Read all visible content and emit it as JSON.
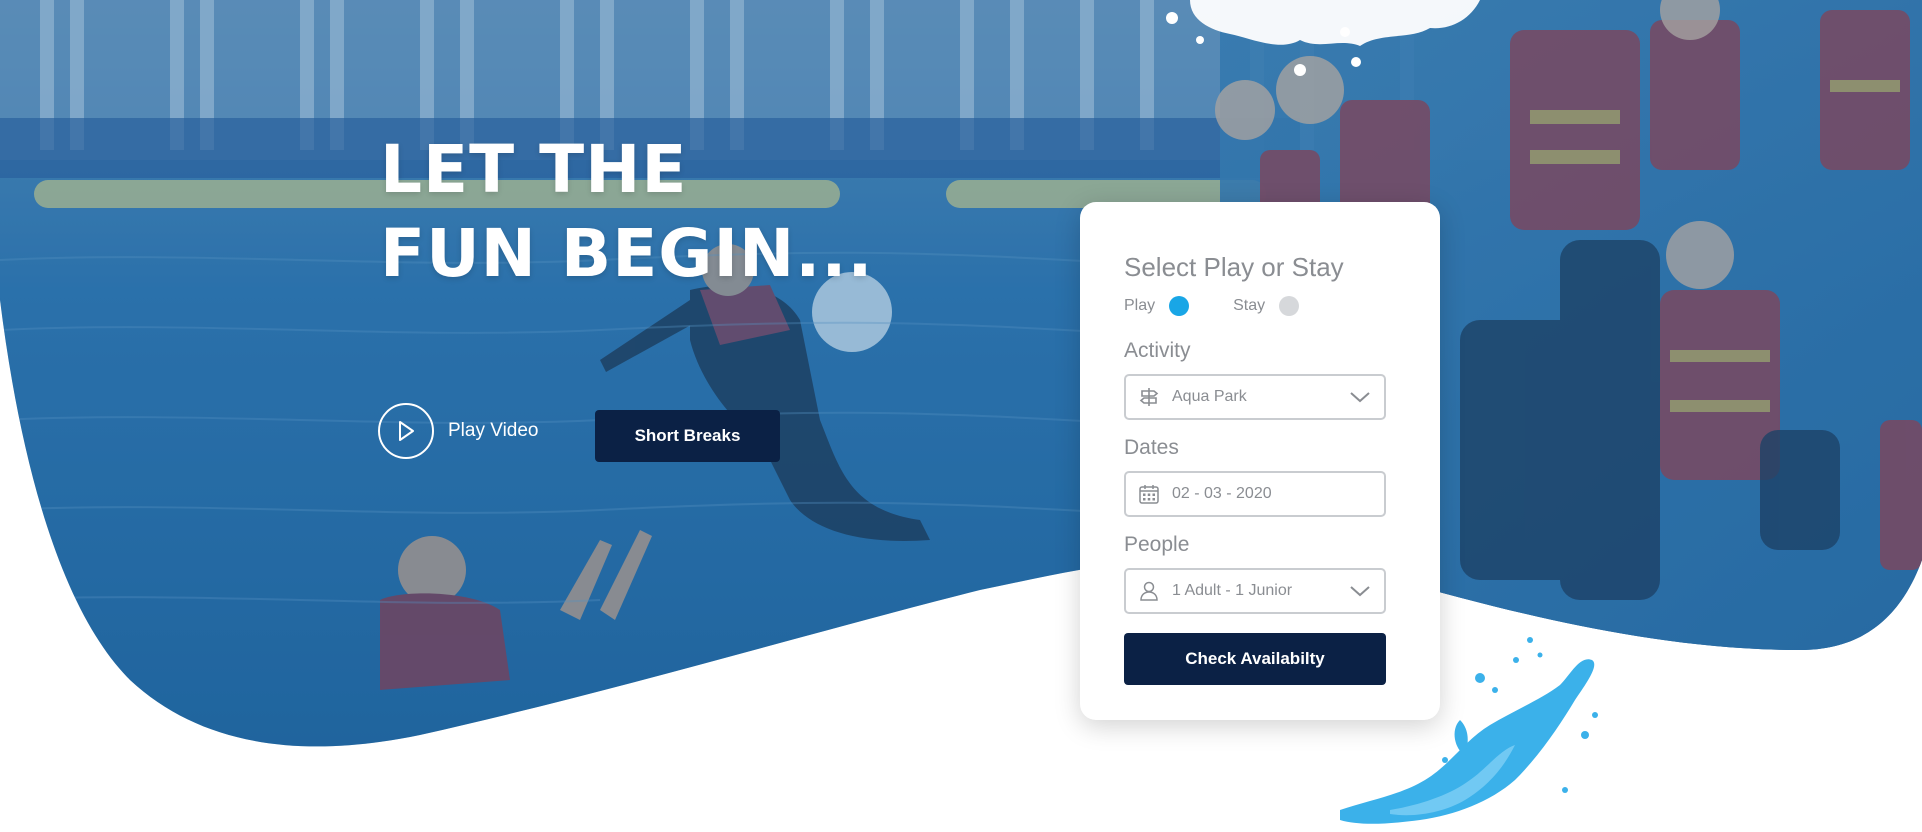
{
  "hero": {
    "headline_line1": "LET THE",
    "headline_line2": "FUN BEGIN...",
    "play_video_label": "Play Video",
    "short_breaks_label": "Short Breaks"
  },
  "booking": {
    "title": "Select Play or Stay",
    "options": [
      {
        "label": "Play",
        "selected": true
      },
      {
        "label": "Stay",
        "selected": false
      }
    ],
    "activity_label": "Activity",
    "activity_value": "Aqua Park",
    "dates_label": "Dates",
    "dates_value": "02 - 03 - 2020",
    "people_label": "People",
    "people_value": "1 Adult - 1 Junior",
    "submit_label": "Check Availabilty"
  },
  "icons": {
    "play": "play-icon",
    "activity": "signpost-icon",
    "dates": "calendar-icon",
    "people": "person-icon",
    "dropdown": "chevron-down-icon"
  },
  "colors": {
    "accent": "#19a6e6",
    "button": "#0b2145",
    "hero_tint": "#1f6aa5",
    "text_muted": "#8a8d92"
  }
}
